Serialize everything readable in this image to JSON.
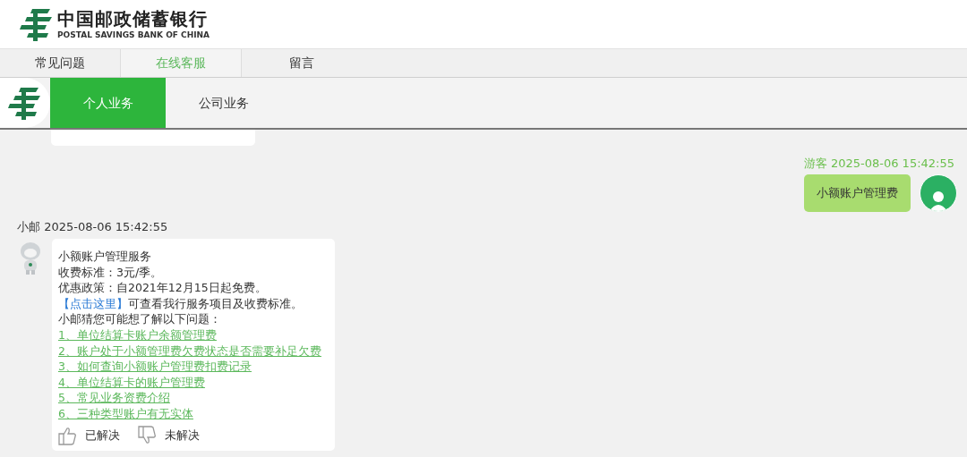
{
  "header": {
    "bank_name": "中国邮政储蓄银行",
    "bank_name_en": "POSTAL SAVINGS BANK OF CHINA"
  },
  "tabs": [
    {
      "label": "常见问题",
      "selected": false
    },
    {
      "label": "在线客服",
      "selected": true
    },
    {
      "label": "留言",
      "selected": false
    }
  ],
  "service_tabs": [
    {
      "label": "个人业务",
      "selected": true
    },
    {
      "label": "公司业务",
      "selected": false
    }
  ],
  "messages": [
    {
      "kind": "user",
      "sender": "游客",
      "time": "2025-08-06 15:42:55",
      "text": "小额账户管理费"
    },
    {
      "kind": "bot",
      "sender": "小邮",
      "time": "2025-08-06 15:42:55",
      "lines": [
        {
          "kind": "text",
          "text": "小额账户管理服务"
        },
        {
          "kind": "text",
          "text": "收费标准：3元/季。"
        },
        {
          "kind": "text",
          "text": "优惠政策：自2021年12月15日起免费。"
        },
        {
          "kind": "link_text",
          "link": "【点击这里】",
          "text": "可查看我行服务项目及收费标准。"
        },
        {
          "kind": "text",
          "text": "小邮猜您可能想了解以下问题："
        },
        {
          "kind": "question",
          "text": "1、单位结算卡账户余额管理费"
        },
        {
          "kind": "question",
          "text": "2、账户处于小额管理费欠费状态是否需要补足欠费"
        },
        {
          "kind": "question",
          "text": "3、如何查询小额账户管理费扣费记录"
        },
        {
          "kind": "question",
          "text": "4、单位结算卡的账户管理费"
        },
        {
          "kind": "question",
          "text": "5、常见业务资费介绍"
        },
        {
          "kind": "question",
          "text": "6、三种类型账户有无实体"
        }
      ],
      "feedback": [
        "已解决",
        "未解决"
      ]
    }
  ]
}
